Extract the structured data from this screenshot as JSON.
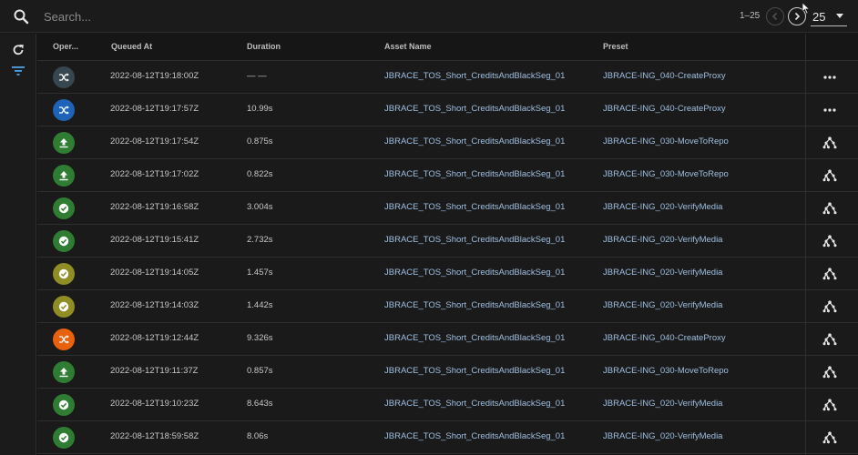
{
  "search": {
    "placeholder": "Search..."
  },
  "pagination": {
    "range": "1–25",
    "per_page": "25"
  },
  "columns": [
    "Oper...",
    "Queued At",
    "Duration",
    "Asset Name",
    "Preset"
  ],
  "colors": {
    "shuffle_dark": "#37474f",
    "shuffle_blue": "#1e63b8",
    "upload_green": "#2e7d32",
    "check_green": "#2e7d32",
    "check_olive": "#8f8d24",
    "shuffle_orange": "#e8620e"
  },
  "rows": [
    {
      "op": "shuffle",
      "op_color": "#37474f",
      "queued": "2022-08-12T19:18:00Z",
      "duration": "— —",
      "asset": "JBRACE_TOS_Short_CreditsAndBlackSeg_01",
      "preset": "JBRACE-ING_040-CreateProxy",
      "action": "more"
    },
    {
      "op": "shuffle",
      "op_color": "#1e63b8",
      "queued": "2022-08-12T19:17:57Z",
      "duration": "10.99s",
      "asset": "JBRACE_TOS_Short_CreditsAndBlackSeg_01",
      "preset": "JBRACE-ING_040-CreateProxy",
      "action": "more"
    },
    {
      "op": "upload",
      "op_color": "#2e7d32",
      "queued": "2022-08-12T19:17:54Z",
      "duration": "0.875s",
      "asset": "JBRACE_TOS_Short_CreditsAndBlackSeg_01",
      "preset": "JBRACE-ING_030-MoveToRepo",
      "action": "graph"
    },
    {
      "op": "upload",
      "op_color": "#2e7d32",
      "queued": "2022-08-12T19:17:02Z",
      "duration": "0.822s",
      "asset": "JBRACE_TOS_Short_CreditsAndBlackSeg_01",
      "preset": "JBRACE-ING_030-MoveToRepo",
      "action": "graph"
    },
    {
      "op": "check",
      "op_color": "#2e7d32",
      "queued": "2022-08-12T19:16:58Z",
      "duration": "3.004s",
      "asset": "JBRACE_TOS_Short_CreditsAndBlackSeg_01",
      "preset": "JBRACE-ING_020-VerifyMedia",
      "action": "graph"
    },
    {
      "op": "check",
      "op_color": "#2e7d32",
      "queued": "2022-08-12T19:15:41Z",
      "duration": "2.732s",
      "asset": "JBRACE_TOS_Short_CreditsAndBlackSeg_01",
      "preset": "JBRACE-ING_020-VerifyMedia",
      "action": "graph"
    },
    {
      "op": "check",
      "op_color": "#8f8d24",
      "queued": "2022-08-12T19:14:05Z",
      "duration": "1.457s",
      "asset": "JBRACE_TOS_Short_CreditsAndBlackSeg_01",
      "preset": "JBRACE-ING_020-VerifyMedia",
      "action": "graph"
    },
    {
      "op": "check",
      "op_color": "#8f8d24",
      "queued": "2022-08-12T19:14:03Z",
      "duration": "1.442s",
      "asset": "JBRACE_TOS_Short_CreditsAndBlackSeg_01",
      "preset": "JBRACE-ING_020-VerifyMedia",
      "action": "graph"
    },
    {
      "op": "shuffle",
      "op_color": "#e8620e",
      "queued": "2022-08-12T19:12:44Z",
      "duration": "9.326s",
      "asset": "JBRACE_TOS_Short_CreditsAndBlackSeg_01",
      "preset": "JBRACE-ING_040-CreateProxy",
      "action": "graph"
    },
    {
      "op": "upload",
      "op_color": "#2e7d32",
      "queued": "2022-08-12T19:11:37Z",
      "duration": "0.857s",
      "asset": "JBRACE_TOS_Short_CreditsAndBlackSeg_01",
      "preset": "JBRACE-ING_030-MoveToRepo",
      "action": "graph"
    },
    {
      "op": "check",
      "op_color": "#2e7d32",
      "queued": "2022-08-12T19:10:23Z",
      "duration": "8.643s",
      "asset": "JBRACE_TOS_Short_CreditsAndBlackSeg_01",
      "preset": "JBRACE-ING_020-VerifyMedia",
      "action": "graph"
    },
    {
      "op": "check",
      "op_color": "#2e7d32",
      "queued": "2022-08-12T18:59:58Z",
      "duration": "8.06s",
      "asset": "JBRACE_TOS_Short_CreditsAndBlackSeg_01",
      "preset": "JBRACE-ING_020-VerifyMedia",
      "action": "graph"
    }
  ]
}
